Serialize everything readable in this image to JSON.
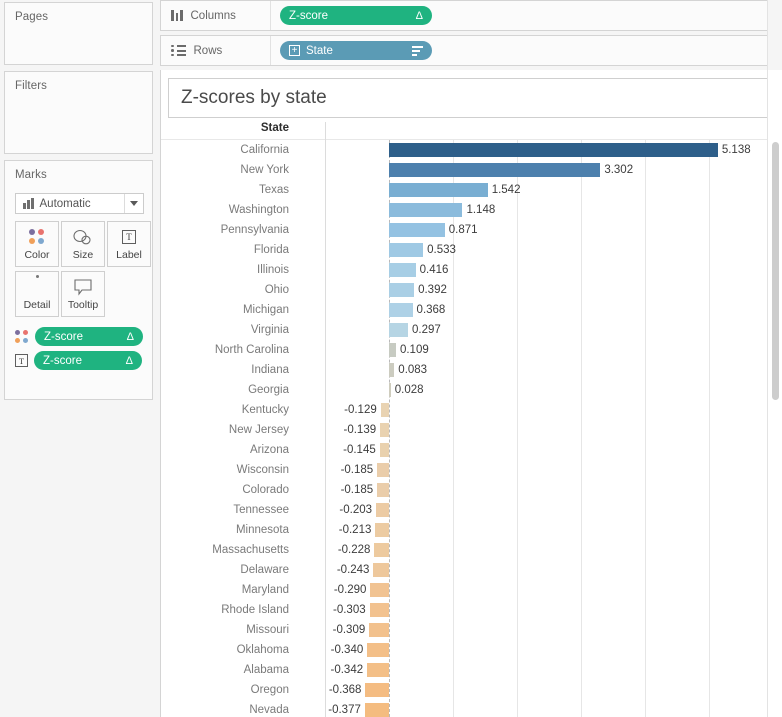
{
  "left_panel": {
    "pages": {
      "title": "Pages"
    },
    "filters": {
      "title": "Filters"
    },
    "marks": {
      "title": "Marks",
      "mark_type": {
        "label": "Automatic",
        "icon": "bar-mark-icon",
        "caret": "chevron-down-icon"
      },
      "buttons": [
        {
          "name": "color",
          "label": "Color",
          "icon": "color-dots-icon"
        },
        {
          "name": "size",
          "label": "Size",
          "icon": "size-circles-icon"
        },
        {
          "name": "label",
          "label": "Label",
          "icon": "label-t-icon"
        },
        {
          "name": "detail",
          "label": "Detail",
          "icon": "detail-dots-icon"
        },
        {
          "name": "tooltip",
          "label": "Tooltip",
          "icon": "tooltip-bubble-icon"
        }
      ],
      "pills": [
        {
          "slot": "color",
          "slot_icon": "color-dots-icon",
          "label": "Z-score",
          "glyph": "Δ"
        },
        {
          "slot": "label",
          "slot_icon": "label-t-icon",
          "label": "Z-score",
          "glyph": "Δ"
        }
      ]
    }
  },
  "shelves": {
    "columns": {
      "label": "Columns",
      "icon": "columns-icon",
      "pill": {
        "label": "Z-score",
        "glyph": "Δ",
        "color": "#1fb380"
      }
    },
    "rows": {
      "label": "Rows",
      "icon": "rows-icon",
      "pill": {
        "label": "State",
        "prefix_icon": "plus-box-icon",
        "prefix_glyph": "＋",
        "sort_icon": "sort-descending-icon",
        "color": "#5b9bb5"
      }
    }
  },
  "view": {
    "title": "Z-scores by state",
    "row_header_label": "State",
    "scrollbar": {
      "name": "vertical-scrollbar"
    }
  },
  "chart_data": {
    "type": "bar",
    "title": "Z-scores by state",
    "xlabel": "Z-score",
    "ylabel": "State",
    "orientation": "horizontal",
    "grid": true,
    "legend": "none",
    "xlim": [
      -0.6,
      5.6
    ],
    "gridlines": [
      1,
      2,
      3,
      4,
      5
    ],
    "zero_line": 0,
    "color_scale": {
      "type": "diverging",
      "positive_high": "#2e5f8a",
      "positive_low": "#c9dced",
      "near_zero": "#cfd1c8",
      "negative": "#f5bb72",
      "negative_low": "#e6cfae"
    },
    "categories": [
      "California",
      "New York",
      "Texas",
      "Washington",
      "Pennsylvania",
      "Florida",
      "Illinois",
      "Ohio",
      "Michigan",
      "Virginia",
      "North Carolina",
      "Indiana",
      "Georgia",
      "Kentucky",
      "New Jersey",
      "Arizona",
      "Wisconsin",
      "Colorado",
      "Tennessee",
      "Minnesota",
      "Massachusetts",
      "Delaware",
      "Maryland",
      "Rhode Island",
      "Missouri",
      "Oklahoma",
      "Alabama",
      "Oregon",
      "Nevada"
    ],
    "values": [
      5.138,
      3.302,
      1.542,
      1.148,
      0.871,
      0.533,
      0.416,
      0.392,
      0.368,
      0.297,
      0.109,
      0.083,
      0.028,
      -0.129,
      -0.139,
      -0.145,
      -0.185,
      -0.185,
      -0.203,
      -0.213,
      -0.228,
      -0.243,
      -0.29,
      -0.303,
      -0.309,
      -0.34,
      -0.342,
      -0.368,
      -0.377
    ],
    "labels": [
      "5.138",
      "3.302",
      "1.542",
      "1.148",
      "0.871",
      "0.533",
      "0.416",
      "0.392",
      "0.368",
      "0.297",
      "0.109",
      "0.083",
      "0.028",
      "-0.129",
      "-0.139",
      "-0.145",
      "-0.185",
      "-0.185",
      "-0.203",
      "-0.213",
      "-0.228",
      "-0.243",
      "-0.290",
      "-0.303",
      "-0.309",
      "-0.340",
      "-0.342",
      "-0.368",
      "-0.377"
    ],
    "bar_colors": [
      "#2e5f8a",
      "#4d80ad",
      "#79aed2",
      "#8bbbdc",
      "#94c2e2",
      "#9fc9e4",
      "#a7cee5",
      "#aacfe5",
      "#aed1e6",
      "#b6d5e4",
      "#c7cbc2",
      "#ccccc0",
      "#cfcdbe",
      "#e9d3b2",
      "#e9d2b0",
      "#e9d1ae",
      "#eacdaa",
      "#eacdaa",
      "#eccba4",
      "#eccba2",
      "#edca9f",
      "#eec89c",
      "#f1c392",
      "#f2c28f",
      "#f2c18d",
      "#f3bf88",
      "#f3bf87",
      "#f4bc82",
      "#f4bc80"
    ]
  }
}
